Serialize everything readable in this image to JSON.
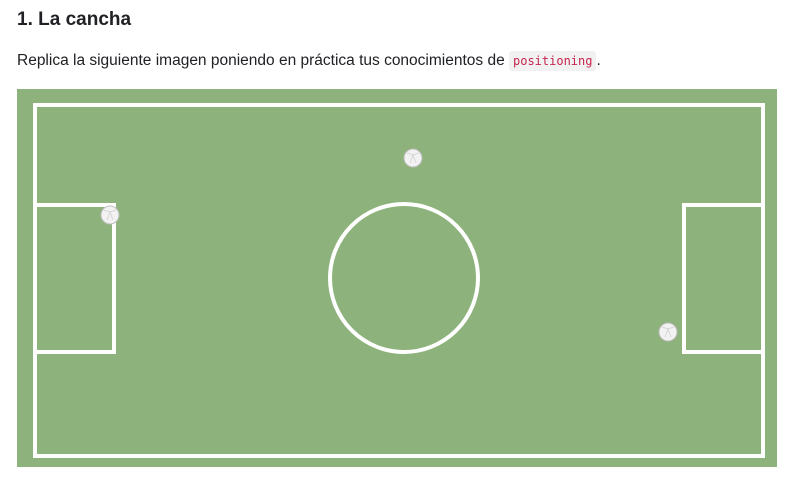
{
  "heading": "1. La cancha",
  "paragraph": {
    "before": "Replica la siguiente imagen poniendo en práctica tus conocimientos de ",
    "code": "positioning",
    "after": "."
  },
  "field": {
    "grass_color": "#8db27b",
    "line_color": "#ffffff",
    "ball_color": "#f2f2f2",
    "balls_count": 3
  }
}
